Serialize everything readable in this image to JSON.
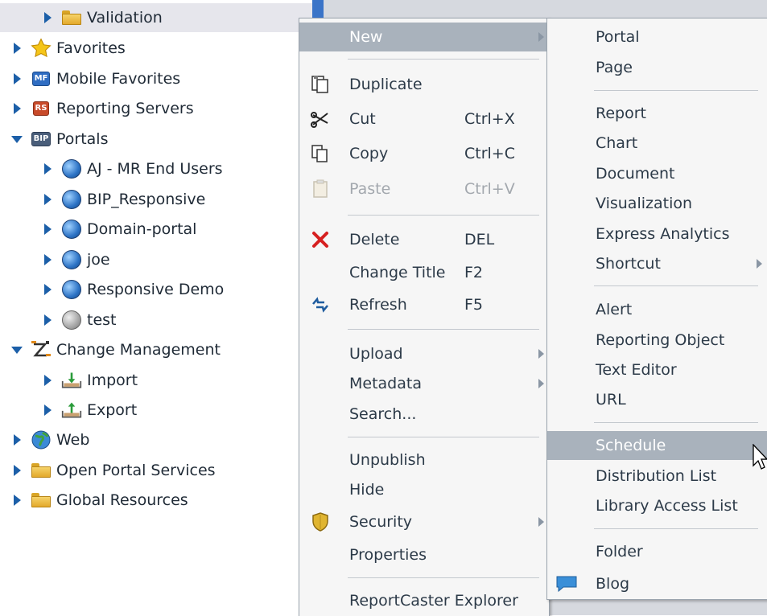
{
  "tree": {
    "items": [
      {
        "label": "Validation",
        "icon": "folder-icon",
        "expand": "collapsed"
      },
      {
        "label": "Favorites",
        "icon": "star-icon",
        "expand": "collapsed"
      },
      {
        "label": "Mobile Favorites",
        "icon": "mobile-favorites-icon",
        "badge": "MF",
        "expand": "collapsed"
      },
      {
        "label": "Reporting Servers",
        "icon": "reporting-servers-icon",
        "badge": "RS",
        "expand": "collapsed"
      },
      {
        "label": "Portals",
        "icon": "portals-icon",
        "badge": "BIP",
        "expand": "expanded"
      },
      {
        "label": "AJ - MR End Users",
        "icon": "portal-globe-icon",
        "expand": "collapsed"
      },
      {
        "label": "BIP_Responsive",
        "icon": "portal-globe-icon",
        "expand": "collapsed"
      },
      {
        "label": "Domain-portal",
        "icon": "portal-globe-icon",
        "expand": "collapsed"
      },
      {
        "label": "joe",
        "icon": "portal-globe-icon",
        "expand": "collapsed"
      },
      {
        "label": "Responsive Demo",
        "icon": "portal-globe-icon",
        "expand": "collapsed"
      },
      {
        "label": "test",
        "icon": "portal-globe-inactive-icon",
        "expand": "collapsed"
      },
      {
        "label": "Change Management",
        "icon": "change-management-icon",
        "expand": "expanded"
      },
      {
        "label": "Import",
        "icon": "import-icon",
        "expand": "collapsed"
      },
      {
        "label": "Export",
        "icon": "export-icon",
        "expand": "collapsed"
      },
      {
        "label": "Web",
        "icon": "web-globe-icon",
        "expand": "collapsed"
      },
      {
        "label": "Open Portal Services",
        "icon": "folder-icon",
        "expand": "collapsed"
      },
      {
        "label": "Global Resources",
        "icon": "folder-icon",
        "expand": "collapsed"
      }
    ]
  },
  "context_menu": {
    "new": "New",
    "duplicate": "Duplicate",
    "cut": "Cut",
    "cut_shortcut": "Ctrl+X",
    "copy": "Copy",
    "copy_shortcut": "Ctrl+C",
    "paste": "Paste",
    "paste_shortcut": "Ctrl+V",
    "delete": "Delete",
    "delete_shortcut": "DEL",
    "change_title": "Change Title",
    "change_title_shortcut": "F2",
    "refresh": "Refresh",
    "refresh_shortcut": "F5",
    "upload": "Upload",
    "metadata": "Metadata",
    "search": "Search...",
    "unpublish": "Unpublish",
    "hide": "Hide",
    "security": "Security",
    "properties": "Properties",
    "reportcaster_explorer": "ReportCaster Explorer"
  },
  "new_submenu": {
    "portal": "Portal",
    "page": "Page",
    "report": "Report",
    "chart": "Chart",
    "document": "Document",
    "visualization": "Visualization",
    "express_analytics": "Express Analytics",
    "shortcut": "Shortcut",
    "alert": "Alert",
    "reporting_object": "Reporting Object",
    "text_editor": "Text Editor",
    "url": "URL",
    "schedule": "Schedule",
    "distribution_list": "Distribution List",
    "library_access_list": "Library Access List",
    "folder": "Folder",
    "blog": "Blog"
  },
  "colors": {
    "tree_arrow": "#1c5fa8",
    "highlight": "#a9b2bc",
    "delete_x": "#d62020"
  }
}
